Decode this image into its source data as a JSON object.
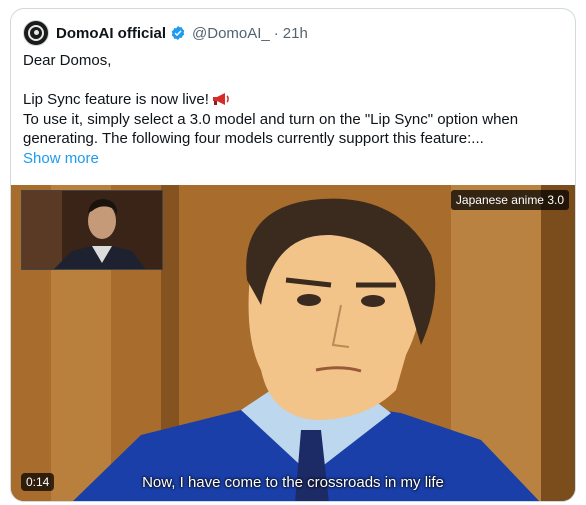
{
  "tweet": {
    "author_name": "DomoAI official",
    "handle": "@DomoAI_",
    "separator": "·",
    "time": "21h",
    "greeting": "Dear Domos,",
    "line1": "Lip Sync feature is now live!",
    "line2": "To use it, simply select a 3.0 model and turn on the \"Lip Sync\" option when generating. The following four models currently support this feature:...",
    "show_more": "Show more"
  },
  "video": {
    "style_badge": "Japanese anime 3.0",
    "duration": "0:14",
    "subtitle": "Now, I have come to the crossroads in my life"
  },
  "icons": {
    "verified": "verified-badge-icon",
    "megaphone": "megaphone-icon"
  },
  "colors": {
    "link": "#1d9bf0",
    "verified": "#1d9bf0",
    "secondary_text": "#536471"
  }
}
